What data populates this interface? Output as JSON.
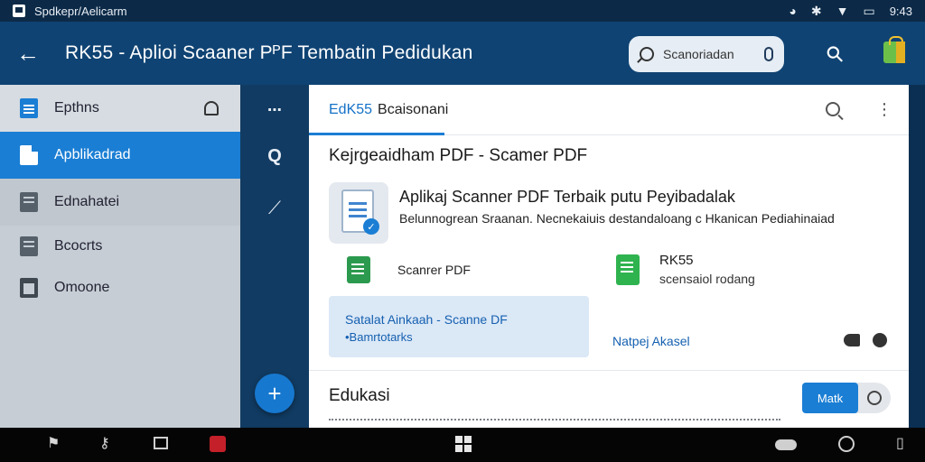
{
  "status_bar": {
    "notification_text": "Spdkepr/Aelicarm",
    "clock": "9:43",
    "icons": [
      "app-icon",
      "alarm-icon",
      "bluetooth-icon",
      "wifi-icon",
      "battery-icon"
    ]
  },
  "app_bar": {
    "back_icon": "arrow-left-icon",
    "title": "RK55 - Aplioi Scaaner PᴾF Tembatin Pedidukan",
    "search_placeholder": "Scanoriadan",
    "icons": [
      "search-icon",
      "mic-icon",
      "wrench-icon",
      "store-bag-icon"
    ]
  },
  "drawer": {
    "items": [
      {
        "label": "Epthns",
        "icon": "document-icon",
        "active": false
      },
      {
        "label": "Apblikadrad",
        "icon": "file-icon",
        "active": true
      },
      {
        "label": "Ednahatei",
        "icon": "folder-icon",
        "active": false
      },
      {
        "label": "Bcocrts",
        "icon": "calendar-icon",
        "active": false
      },
      {
        "label": "Omoone",
        "icon": "box-icon",
        "active": false
      }
    ]
  },
  "rail": {
    "items": [
      "menu-icon",
      "search-icon",
      "wand-icon"
    ],
    "fab_label": "+"
  },
  "main": {
    "tabs": [
      {
        "label": "EdK55",
        "active": true
      },
      {
        "label": "Bcaisonani",
        "active": false
      }
    ],
    "section_title": "Kejrgeaidham PDF - Scamer PDF",
    "app": {
      "title": "Aplikaj Scanner PDF Terbaik putu Peyibadalak",
      "description": "Belunnogrean Sraanan. Necnekaiuis destandaloang c Hkanican Pediahinaiad"
    },
    "features": [
      {
        "label": "Scanrer PDF"
      },
      {
        "label": "RK55",
        "sub": "scensaiol rodang"
      }
    ],
    "promo": {
      "title": "Satalat Ainkaah - Scanne DF",
      "subtitle": "•Bamrtotarks"
    },
    "link_text": "Natpej Akasel",
    "education_title": "Edukasi",
    "action_button": "Matk"
  },
  "colors": {
    "app_bar": "#0f4373",
    "accent": "#1a7ed4",
    "drawer_bg": "#c6cdd4",
    "rail_bg": "#113b62"
  }
}
